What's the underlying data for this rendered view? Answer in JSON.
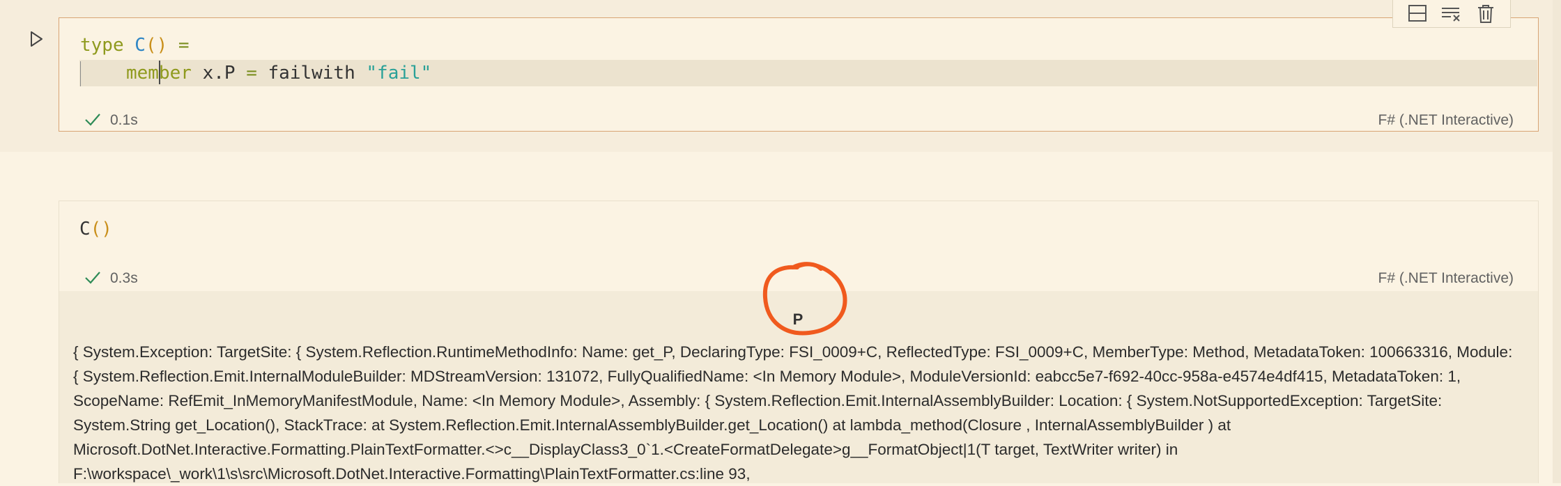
{
  "cells": [
    {
      "code_lines": [
        [
          {
            "text": "type",
            "kind": "kw"
          },
          {
            "text": " ",
            "kind": "plain"
          },
          {
            "text": "C",
            "kind": "type-name"
          },
          {
            "text": "()",
            "kind": "paren"
          },
          {
            "text": " ",
            "kind": "plain"
          },
          {
            "text": "=",
            "kind": "op"
          }
        ],
        [
          {
            "text": "member",
            "kind": "kw"
          },
          {
            "text": " x.P ",
            "kind": "plain"
          },
          {
            "text": "=",
            "kind": "op"
          },
          {
            "text": " failwith ",
            "kind": "plain"
          },
          {
            "text": "\"fail\"",
            "kind": "str"
          }
        ]
      ],
      "status": {
        "time": "0.1s",
        "success": true
      },
      "kernel": "F# (.NET Interactive)"
    },
    {
      "code_lines": [
        [
          {
            "text": "C",
            "kind": "plain"
          },
          {
            "text": "()",
            "kind": "paren"
          }
        ]
      ],
      "status": {
        "time": "0.3s",
        "success": true
      },
      "kernel": "F# (.NET Interactive)",
      "output": {
        "header": "P",
        "text": "{ System.Exception: TargetSite: { System.Reflection.RuntimeMethodInfo: Name: get_P, DeclaringType: FSI_0009+C, ReflectedType: FSI_0009+C, MemberType: Method, MetadataToken: 100663316, Module: { System.Reflection.Emit.InternalModuleBuilder: MDStreamVersion: 131072, FullyQualifiedName: <In Memory Module>, ModuleVersionId: eabcc5e7-f692-40cc-958a-e4574e4df415, MetadataToken: 1, ScopeName: RefEmit_InMemoryManifestModule, Name: <In Memory Module>, Assembly: { System.Reflection.Emit.InternalAssemblyBuilder: Location: { System.NotSupportedException: TargetSite: System.String get_Location(), StackTrace: at System.Reflection.Emit.InternalAssemblyBuilder.get_Location() at lambda_method(Closure , InternalAssemblyBuilder ) at Microsoft.DotNet.Interactive.Formatting.PlainTextFormatter.<>c__DisplayClass3_0`1.<CreateFormatDelegate>g__FormatObject|1(T target, TextWriter writer) in F:\\workspace\\_work\\1\\s\\src\\Microsoft.DotNet.Interactive.Formatting\\PlainTextFormatter.cs:line 93,"
      }
    }
  ],
  "toolbar": {
    "buttons": [
      {
        "icon": "split-cell-icon"
      },
      {
        "icon": "clear-output-icon"
      },
      {
        "icon": "delete-icon"
      }
    ]
  },
  "colors": {
    "accent_border": "#d8a474",
    "annotation": "#f05a1e",
    "check": "#2e8b57"
  }
}
